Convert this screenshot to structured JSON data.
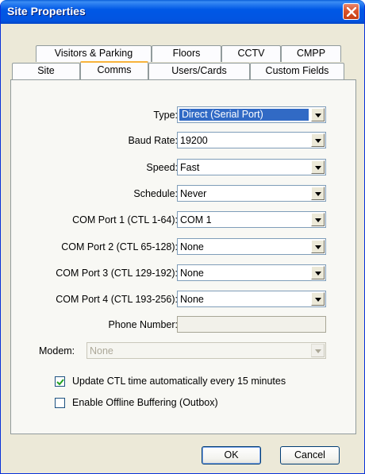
{
  "window": {
    "title": "Site Properties"
  },
  "tabs": {
    "row1": [
      "Visitors & Parking",
      "Floors",
      "CCTV",
      "CMPP"
    ],
    "row2": [
      "Site",
      "Comms",
      "Users/Cards",
      "Custom Fields"
    ],
    "active": "Comms"
  },
  "form": {
    "type": {
      "label": "Type:",
      "value": "Direct (Serial Port)"
    },
    "baud_rate": {
      "label": "Baud Rate:",
      "value": "19200"
    },
    "speed": {
      "label": "Speed:",
      "value": "Fast"
    },
    "schedule": {
      "label": "Schedule:",
      "value": "Never"
    },
    "com1": {
      "label": "COM Port 1 (CTL 1-64):",
      "value": "COM 1"
    },
    "com2": {
      "label": "COM Port 2 (CTL 65-128):",
      "value": "None"
    },
    "com3": {
      "label": "COM Port 3 (CTL 129-192):",
      "value": "None"
    },
    "com4": {
      "label": "COM Port 4 (CTL 193-256):",
      "value": "None"
    },
    "phone": {
      "label": "Phone Number:",
      "value": ""
    },
    "modem": {
      "label": "Modem:",
      "value": "None"
    },
    "update_ctl": {
      "label": "Update CTL time automatically every 15 minutes",
      "checked": true
    },
    "offline_buffering": {
      "label": "Enable Offline Buffering (Outbox)",
      "checked": false
    }
  },
  "buttons": {
    "ok": "OK",
    "cancel": "Cancel"
  }
}
